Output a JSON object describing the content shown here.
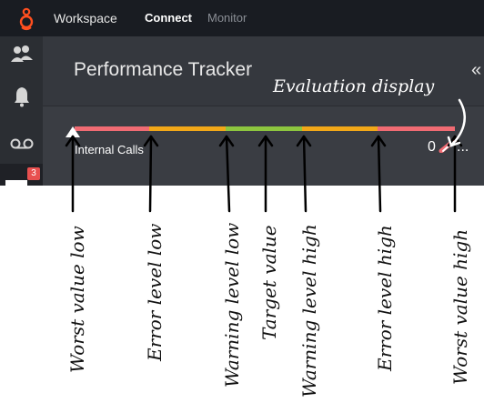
{
  "topbar": {
    "nav": [
      {
        "label": "Workspace"
      },
      {
        "label": "Connect"
      },
      {
        "label": "Monitor"
      }
    ]
  },
  "sidebar": {
    "items": [
      {
        "icon": "contacts-icon"
      },
      {
        "icon": "bell-icon"
      },
      {
        "icon": "voicemail-icon"
      },
      {
        "icon": "messages-icon",
        "badge": "3"
      }
    ]
  },
  "panel": {
    "title": "Performance Tracker",
    "collapse_label": "«"
  },
  "metric": {
    "label": "Internal Calls",
    "value": "0",
    "more": "..."
  },
  "colors": {
    "error": "#f06b73",
    "warning": "#f2a818",
    "target": "#8dc63f",
    "badge": "#e8504f"
  },
  "annotations": {
    "evaluation": "Evaluation display",
    "worst_low": "Worst value low",
    "error_low": "Error level low",
    "warning_low": "Warning level low",
    "target": "Target value",
    "warning_high": "Warning level high",
    "error_high": "Error level high",
    "worst_high": "Worst value high"
  }
}
